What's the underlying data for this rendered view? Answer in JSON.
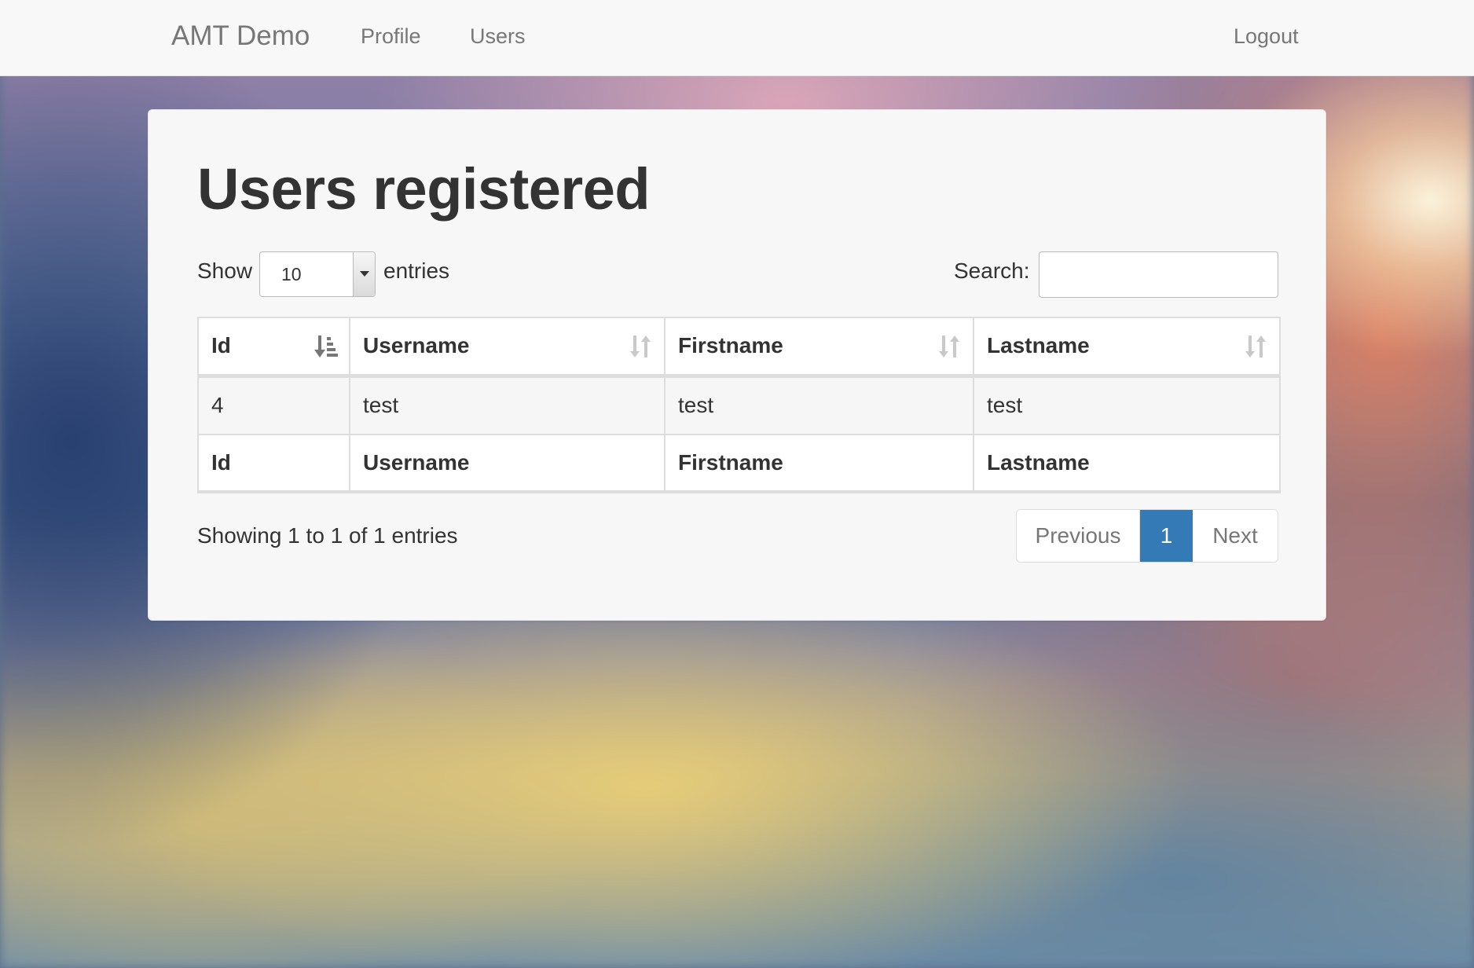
{
  "navbar": {
    "brand": "AMT Demo",
    "links": [
      "Profile",
      "Users"
    ],
    "logout": "Logout"
  },
  "page": {
    "title": "Users registered"
  },
  "length_menu": {
    "show_label": "Show",
    "selected": "10",
    "entries_label": "entries"
  },
  "search": {
    "label": "Search:",
    "value": "",
    "placeholder": ""
  },
  "table": {
    "columns": [
      "Id",
      "Username",
      "Firstname",
      "Lastname"
    ],
    "sort": {
      "column": "Id",
      "direction": "ascending"
    },
    "rows": [
      [
        "4",
        "test",
        "test",
        "test"
      ]
    ],
    "footer": [
      "Id",
      "Username",
      "Firstname",
      "Lastname"
    ]
  },
  "info": "Showing 1 to 1 of 1 entries",
  "pagination": {
    "previous": "Previous",
    "current": "1",
    "next": "Next"
  },
  "colors": {
    "accent": "#337ab7",
    "navbar_bg": "#f8f8f8",
    "panel_bg": "#f7f7f7"
  },
  "icons": {
    "sort_asc": "sort-ascending-icon",
    "sort_both": "sort-both-icon",
    "select_arrow": "caret-down-icon"
  }
}
